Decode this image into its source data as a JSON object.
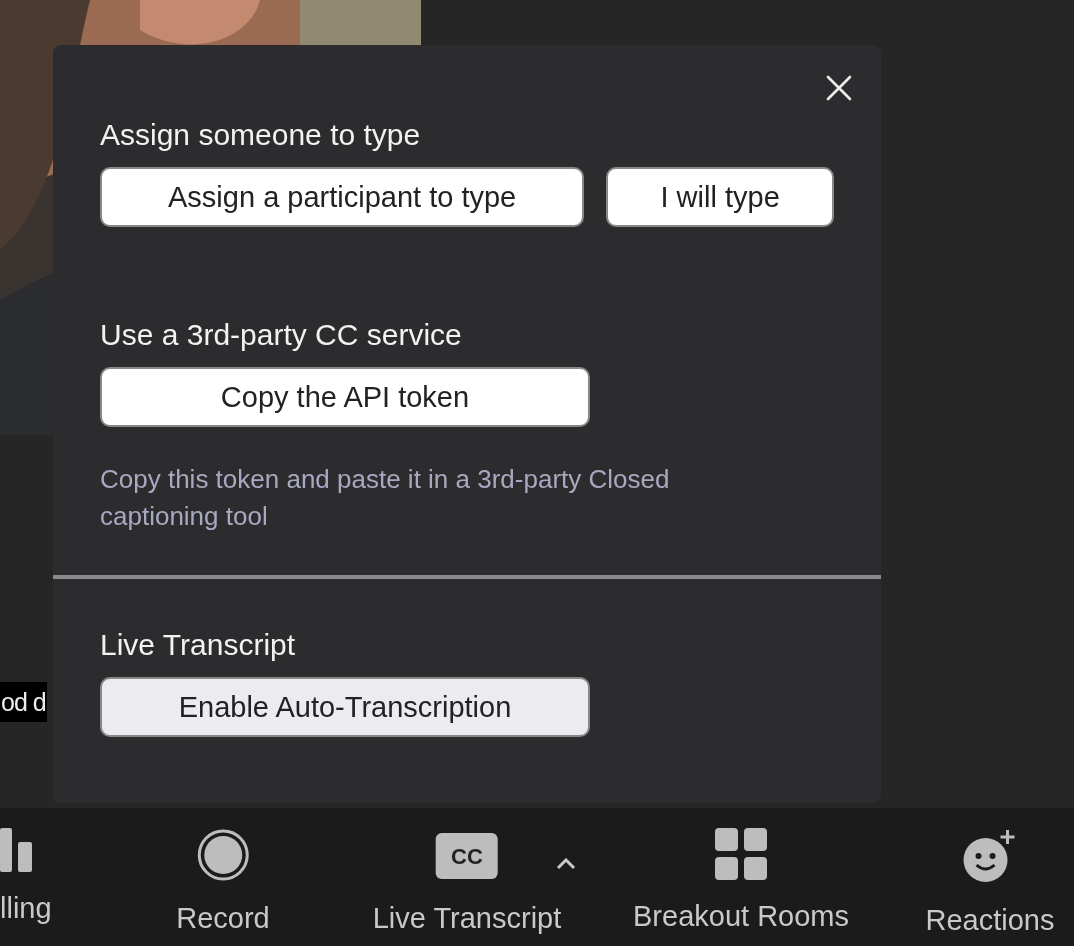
{
  "caption": "od d",
  "panel": {
    "sections": [
      {
        "title": "Assign someone to type",
        "buttons": [
          "Assign a participant to type",
          "I will type"
        ]
      },
      {
        "title": "Use a 3rd-party CC service",
        "buttons": [
          "Copy the API token"
        ],
        "note": "Copy this token and paste it in a 3rd-party Closed captioning tool"
      },
      {
        "title": "Live Transcript",
        "buttons": [
          "Enable Auto-Transcription"
        ]
      }
    ]
  },
  "toolbar": [
    {
      "kind": "bars",
      "label": "lling"
    },
    {
      "kind": "record",
      "label": "Record"
    },
    {
      "kind": "cc",
      "label": "Live Transcript",
      "badge": "CC"
    },
    {
      "kind": "grid",
      "label": "Breakout Rooms"
    },
    {
      "kind": "emoji",
      "label": "Reactions"
    }
  ]
}
